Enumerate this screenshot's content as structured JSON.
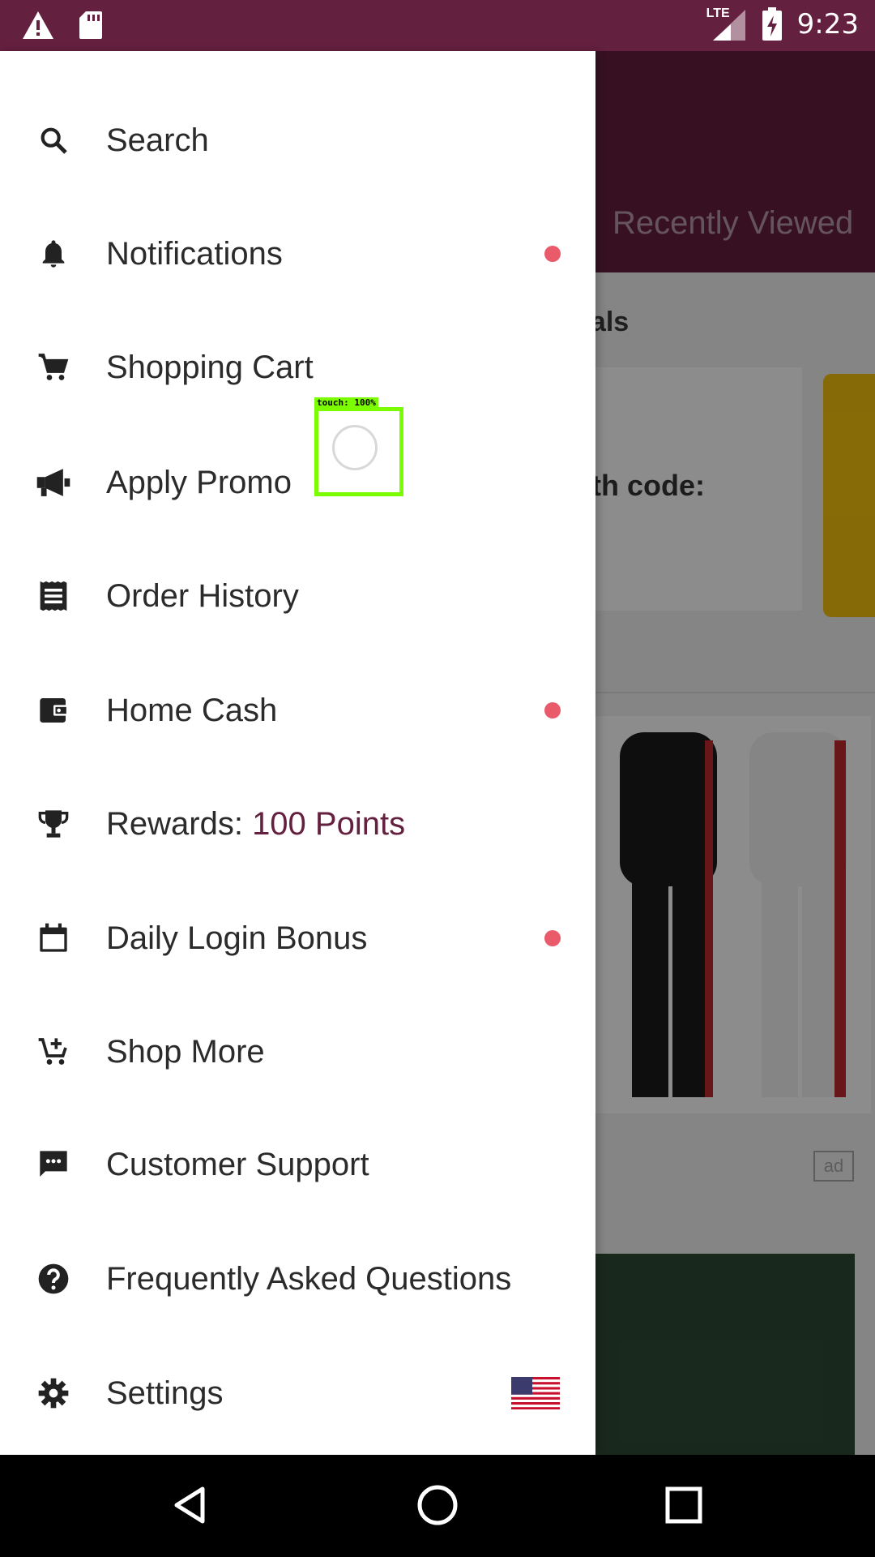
{
  "status_bar": {
    "time": "9:23",
    "network": "LTE",
    "icons": [
      "warning-icon",
      "sd-card-icon",
      "signal-icon",
      "battery-charging-icon"
    ]
  },
  "background": {
    "header_tab": "Recently Viewed",
    "deals_title": "eals",
    "promo_text": "th code:",
    "ad_label": "ad"
  },
  "drawer": {
    "items": [
      {
        "label": "Search",
        "icon": "search-icon",
        "badge": false
      },
      {
        "label": "Notifications",
        "icon": "bell-icon",
        "badge": true
      },
      {
        "label": "Shopping Cart",
        "icon": "cart-icon",
        "badge": false
      },
      {
        "label": "Apply Promo",
        "icon": "megaphone-icon",
        "badge": false
      },
      {
        "label": "Order History",
        "icon": "receipt-icon",
        "badge": false
      },
      {
        "label": "Home Cash",
        "icon": "wallet-icon",
        "badge": true
      },
      {
        "label": "Rewards: ",
        "points": "100 Points",
        "icon": "trophy-icon",
        "badge": false
      },
      {
        "label": "Daily Login Bonus",
        "icon": "calendar-icon",
        "badge": true
      },
      {
        "label": "Shop More",
        "icon": "add-cart-icon",
        "badge": false
      },
      {
        "label": "Customer Support",
        "icon": "chat-icon",
        "badge": false
      },
      {
        "label": "Frequently Asked Questions",
        "icon": "help-icon",
        "badge": false
      },
      {
        "label": "Settings",
        "icon": "gear-icon",
        "badge": false,
        "flag": "us-flag-icon"
      }
    ],
    "badge_color": "#E95A6A",
    "accent_color": "#64203F"
  },
  "touch_overlay": {
    "label": "touch: 100%"
  },
  "nav_bar": {
    "buttons": [
      "back-icon",
      "home-icon",
      "recents-icon"
    ]
  }
}
